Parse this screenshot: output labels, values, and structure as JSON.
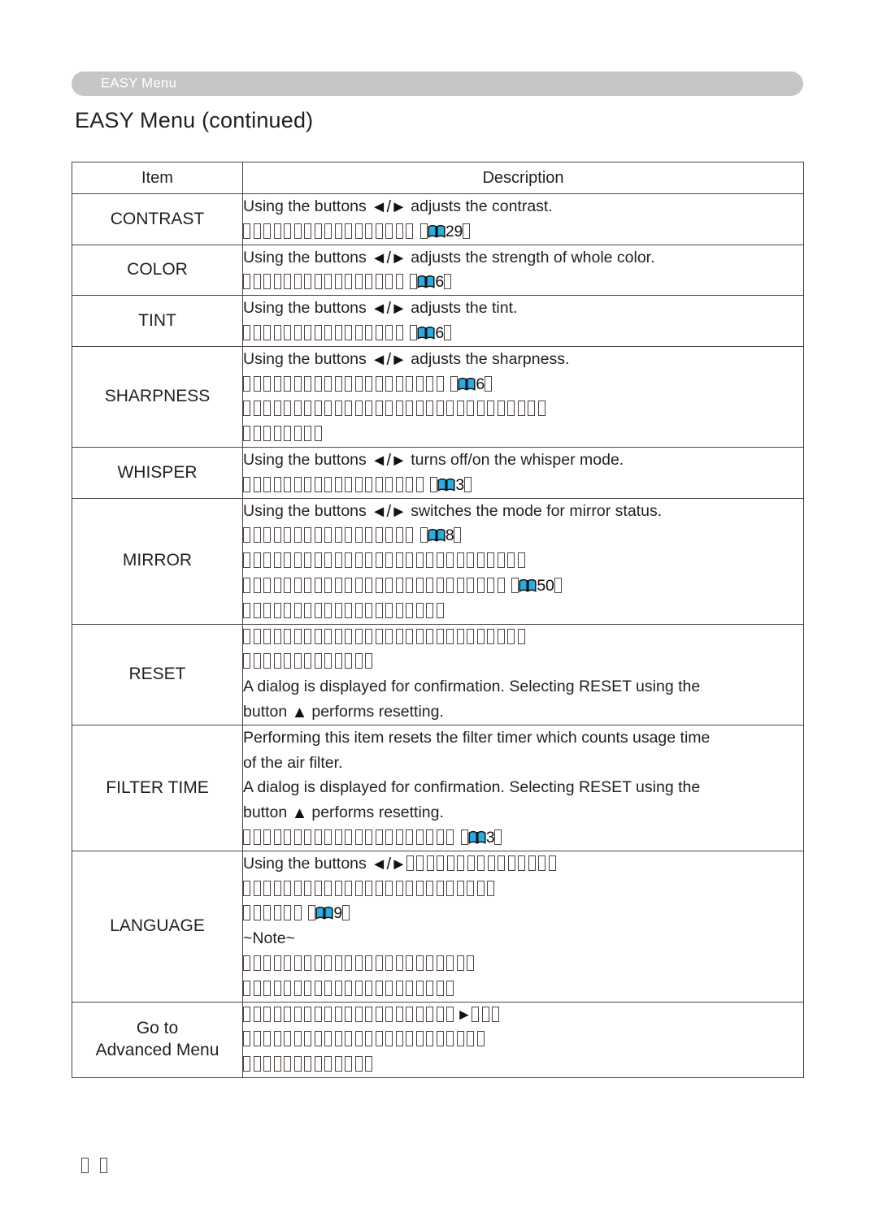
{
  "header": {
    "banner_label": "EASY Menu",
    "banner_color": "#c6c6c6",
    "page_title": "EASY Menu (continued)"
  },
  "table": {
    "columns": [
      "Item",
      "Description"
    ],
    "rows": [
      {
        "item": "CONTRAST",
        "lines": [
          {
            "text": "Using the buttons ◄/► adjusts the contrast.",
            "type": "text"
          },
          {
            "type": "tofu-run",
            "count": 17,
            "page_ref": "29"
          }
        ]
      },
      {
        "item": "COLOR",
        "lines": [
          {
            "text": "Using the buttons ◄/► adjusts the strength of whole color.",
            "type": "text"
          },
          {
            "type": "tofu-run",
            "count": 16,
            "page_ref": "6"
          }
        ]
      },
      {
        "item": "TINT",
        "lines": [
          {
            "text": "Using the buttons ◄/► adjusts the tint.",
            "type": "text"
          },
          {
            "type": "tofu-run",
            "count": 16,
            "page_ref": "6"
          }
        ]
      },
      {
        "item": "SHARPNESS",
        "lines": [
          {
            "text": "Using the buttons ◄/► adjusts the sharpness.",
            "type": "text"
          },
          {
            "type": "tofu-run",
            "count": 20,
            "page_ref": "6"
          },
          {
            "type": "tofu-run",
            "count": 30,
            "page_ref": null
          },
          {
            "type": "tofu-run",
            "count": 8,
            "page_ref": null
          }
        ]
      },
      {
        "item": "WHISPER",
        "lines": [
          {
            "text": "Using the buttons ◄/► turns off/on the whisper mode.",
            "type": "text"
          },
          {
            "type": "tofu-run",
            "count": 18,
            "page_ref": "3"
          }
        ]
      },
      {
        "item": "MIRROR",
        "lines": [
          {
            "text": "Using the buttons ◄/► switches the mode for mirror status.",
            "type": "text"
          },
          {
            "type": "tofu-run",
            "count": 17,
            "page_ref": "8"
          },
          {
            "type": "tofu-run",
            "count": 28,
            "page_ref": null
          },
          {
            "type": "tofu-run",
            "count": 26,
            "page_ref": "50"
          },
          {
            "type": "tofu-run",
            "count": 20,
            "page_ref": null
          }
        ]
      },
      {
        "item": "RESET",
        "lines": [
          {
            "type": "tofu-run",
            "count": 28,
            "page_ref": null
          },
          {
            "type": "tofu-run",
            "count": 13,
            "page_ref": null
          },
          {
            "text": "A dialog is displayed for confirmation. Selecting RESET using the",
            "type": "text"
          },
          {
            "text": "button ▲ performs resetting.",
            "type": "text"
          }
        ]
      },
      {
        "item": "FILTER TIME",
        "lines": [
          {
            "text": "Performing this item resets the filter timer which counts usage time",
            "type": "text"
          },
          {
            "text": "of the air filter.",
            "type": "text"
          },
          {
            "text": "A dialog is displayed for confirmation. Selecting RESET using the",
            "type": "text"
          },
          {
            "text": "button ▲ performs resetting.",
            "type": "text"
          },
          {
            "type": "tofu-run",
            "count": 21,
            "page_ref": "3"
          }
        ]
      },
      {
        "item": "LANGUAGE",
        "lines": [
          {
            "text": "Using the buttons ◄/►",
            "type": "text-tofu",
            "count": 15
          },
          {
            "type": "tofu-run",
            "count": 25,
            "page_ref": null
          },
          {
            "type": "tofu-run",
            "count": 6,
            "page_ref": "9"
          },
          {
            "text": "~Note~",
            "type": "text"
          },
          {
            "type": "tofu-run",
            "count": 23,
            "page_ref": null
          },
          {
            "type": "tofu-run",
            "count": 21,
            "page_ref": null
          }
        ]
      },
      {
        "item": "Go to\nAdvanced Menu",
        "item_line1": "Go to",
        "item_line2": "Advanced Menu",
        "lines": [
          {
            "type": "tofu-run-arrow",
            "count": 21,
            "after_count": 3
          },
          {
            "type": "tofu-run",
            "count": 24,
            "page_ref": null
          },
          {
            "type": "tofu-run",
            "count": 13,
            "page_ref": null
          }
        ]
      }
    ]
  },
  "footer": {
    "tofu_count": 2
  },
  "colors": {
    "book_icon_blue": "#29ace3",
    "book_icon_outline": "#111111",
    "table_border": "#4d4340",
    "text": "#231f20"
  }
}
